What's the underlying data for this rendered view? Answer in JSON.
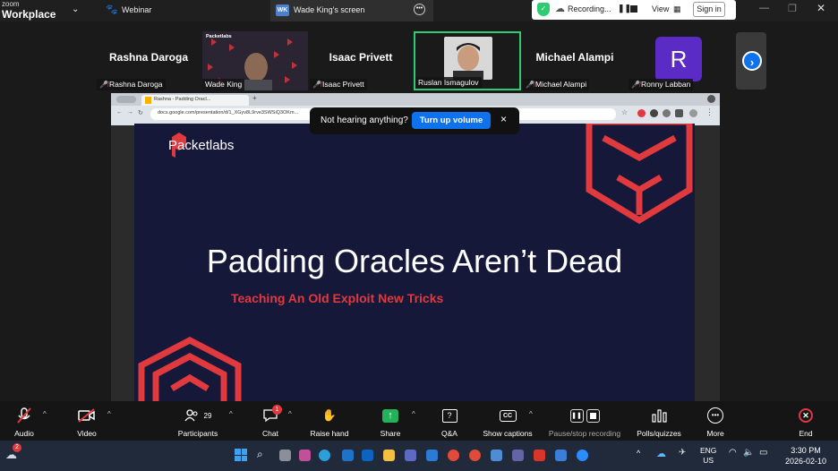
{
  "topbar": {
    "brand_small": "zoom",
    "brand_large": "Workplace",
    "webinar_label": "Webinar",
    "share_tab_badge": "WK",
    "share_tab_label": "Wade King's screen",
    "recording_label": "Recording...",
    "view_label": "View",
    "signin_label": "Sign in"
  },
  "participants": [
    {
      "name": "Rashna Daroga",
      "tag": "Rashna Daroga",
      "muted": true,
      "kind": "name"
    },
    {
      "name": "",
      "tag": "Wade King",
      "muted": false,
      "kind": "video"
    },
    {
      "name": "Isaac Privett",
      "tag": "Isaac Privett",
      "muted": true,
      "kind": "name"
    },
    {
      "name": "",
      "tag": "Ruslan Ismagulov",
      "muted": false,
      "kind": "video-active"
    },
    {
      "name": "Michael Alampi",
      "tag": "Michael Alampi",
      "muted": true,
      "kind": "name"
    },
    {
      "name": "R",
      "tag": "Ronny Labban",
      "muted": true,
      "kind": "avatar"
    }
  ],
  "browser": {
    "tab_label": "Rashna - Padding Oracl...",
    "url": "docs.google.com/presentation/d/1_XGyv8L9rve3SWSiQ3OKm..."
  },
  "toast": {
    "message": "Not hearing anything?",
    "button": "Turn up volume",
    "close": "×"
  },
  "slide": {
    "logo_text": "Packetlabs",
    "title": "Padding Oracles Aren’t Dead",
    "subtitle": "Teaching An Old Exploit New Tricks"
  },
  "toolbar": {
    "audio": "Audio",
    "video": "Video",
    "participants": "Participants",
    "participants_count": "29",
    "chat": "Chat",
    "chat_badge": "1",
    "raise_hand": "Raise hand",
    "share": "Share",
    "qa": "Q&A",
    "captions": "Show captions",
    "record": "Pause/stop recording",
    "polls": "Polls/quizzes",
    "more": "More",
    "end": "End"
  },
  "taskbar": {
    "weather_badge": "2",
    "lang_top": "ENG",
    "lang_bottom": "US",
    "time": "3:30 PM",
    "date": "2026-02-10"
  },
  "colors": {
    "accent_blue": "#0e72ed",
    "slide_bg": "#16183a",
    "packet_red": "#e0393e",
    "active_green": "#2ecc71"
  }
}
